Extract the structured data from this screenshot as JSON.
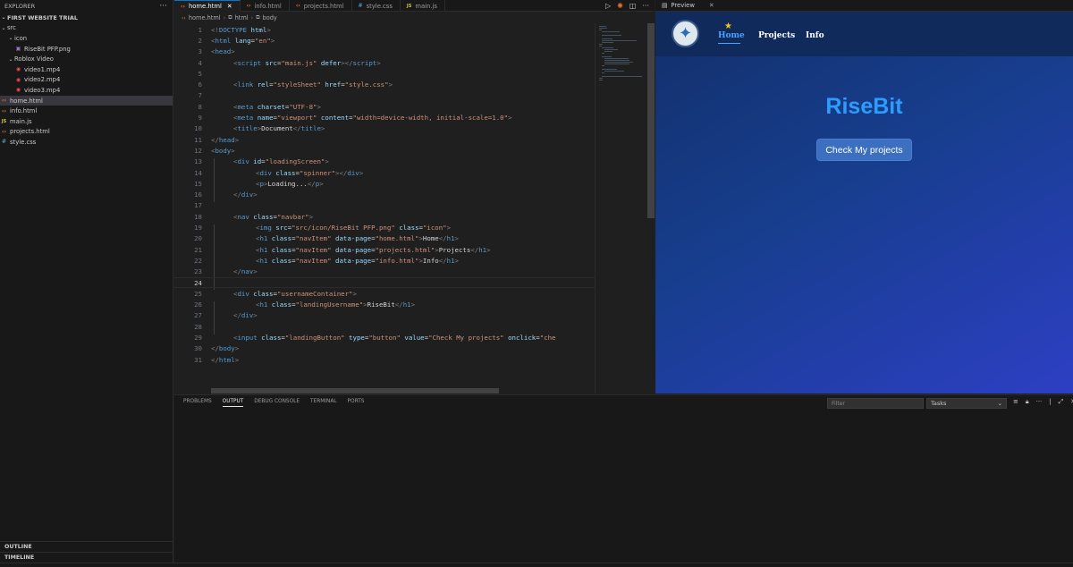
{
  "sidebar": {
    "title": "EXPLORER",
    "more": "···",
    "project": "FIRST WEBSITE TRIAL",
    "tree": [
      {
        "label": "src",
        "icon": "chevron-down",
        "depth": 1,
        "kind": "folder"
      },
      {
        "label": "icon",
        "icon": "chevron-down",
        "depth": 2,
        "kind": "folder"
      },
      {
        "label": "RiseBit PFP.png",
        "icon": "png-file-icon",
        "depth": 3,
        "kind": "png"
      },
      {
        "label": "Roblox Video",
        "icon": "chevron-down",
        "depth": 2,
        "kind": "folder"
      },
      {
        "label": "video1.mp4",
        "icon": "video-file-icon",
        "depth": 3,
        "kind": "mp4"
      },
      {
        "label": "video2.mp4",
        "icon": "video-file-icon",
        "depth": 3,
        "kind": "mp4"
      },
      {
        "label": "video3.mp4",
        "icon": "video-file-icon",
        "depth": 3,
        "kind": "mp4"
      },
      {
        "label": "home.html",
        "icon": "html-file-icon",
        "depth": 1,
        "kind": "html",
        "selected": true
      },
      {
        "label": "info.html",
        "icon": "html-file-icon",
        "depth": 1,
        "kind": "html"
      },
      {
        "label": "main.js",
        "icon": "js-file-icon",
        "depth": 1,
        "kind": "js"
      },
      {
        "label": "projects.html",
        "icon": "html-file-icon",
        "depth": 1,
        "kind": "html"
      },
      {
        "label": "style.css",
        "icon": "css-file-icon",
        "depth": 1,
        "kind": "css"
      }
    ],
    "outline": "OUTLINE",
    "timeline": "TIMELINE"
  },
  "tabs": [
    {
      "label": "home.html",
      "kind": "html",
      "active": true
    },
    {
      "label": "info.html",
      "kind": "html"
    },
    {
      "label": "projects.html",
      "kind": "html"
    },
    {
      "label": "style.css",
      "kind": "css"
    },
    {
      "label": "main.js",
      "kind": "js"
    }
  ],
  "breadcrumb": [
    "home.html",
    "html",
    "body"
  ],
  "editor": {
    "current_line": 24,
    "lines": [
      {
        "n": 1,
        "indent": 0,
        "tokens": [
          [
            "t",
            "<!"
          ],
          [
            "n",
            "DOCTYPE"
          ],
          [
            "a",
            " html"
          ],
          [
            "t",
            ">"
          ]
        ]
      },
      {
        "n": 2,
        "indent": 0,
        "tokens": [
          [
            "t",
            "<"
          ],
          [
            "n",
            "html"
          ],
          [
            "a",
            " lang"
          ],
          [
            "x",
            "="
          ],
          [
            "s",
            "\"en\""
          ],
          [
            "t",
            ">"
          ]
        ]
      },
      {
        "n": 3,
        "indent": 0,
        "tokens": [
          [
            "t",
            "<"
          ],
          [
            "n",
            "head"
          ],
          [
            "t",
            ">"
          ]
        ]
      },
      {
        "n": 4,
        "indent": 1,
        "tokens": [
          [
            "t",
            "<"
          ],
          [
            "n",
            "script"
          ],
          [
            "a",
            " src"
          ],
          [
            "x",
            "="
          ],
          [
            "s",
            "\"main.js\""
          ],
          [
            "a",
            " defer"
          ],
          [
            "t",
            "></"
          ],
          [
            "n",
            "script"
          ],
          [
            "t",
            ">"
          ]
        ]
      },
      {
        "n": 5,
        "indent": 0,
        "tokens": []
      },
      {
        "n": 6,
        "indent": 1,
        "tokens": [
          [
            "t",
            "<"
          ],
          [
            "n",
            "link"
          ],
          [
            "a",
            " rel"
          ],
          [
            "x",
            "="
          ],
          [
            "s",
            "\"styleSheet\""
          ],
          [
            "a",
            " href"
          ],
          [
            "x",
            "="
          ],
          [
            "s",
            "\"style.css\""
          ],
          [
            "t",
            ">"
          ]
        ]
      },
      {
        "n": 7,
        "indent": 0,
        "tokens": []
      },
      {
        "n": 8,
        "indent": 1,
        "tokens": [
          [
            "t",
            "<"
          ],
          [
            "n",
            "meta"
          ],
          [
            "a",
            " charset"
          ],
          [
            "x",
            "="
          ],
          [
            "s",
            "\"UTF-8\""
          ],
          [
            "t",
            ">"
          ]
        ]
      },
      {
        "n": 9,
        "indent": 1,
        "tokens": [
          [
            "t",
            "<"
          ],
          [
            "n",
            "meta"
          ],
          [
            "a",
            " name"
          ],
          [
            "x",
            "="
          ],
          [
            "s",
            "\"viewport\""
          ],
          [
            "a",
            " content"
          ],
          [
            "x",
            "="
          ],
          [
            "s",
            "\"width=device-width, initial-scale=1.0\""
          ],
          [
            "t",
            ">"
          ]
        ]
      },
      {
        "n": 10,
        "indent": 1,
        "tokens": [
          [
            "t",
            "<"
          ],
          [
            "n",
            "title"
          ],
          [
            "t",
            ">"
          ],
          [
            "x",
            "Document"
          ],
          [
            "t",
            "</"
          ],
          [
            "n",
            "title"
          ],
          [
            "t",
            ">"
          ]
        ]
      },
      {
        "n": 11,
        "indent": 0,
        "tokens": [
          [
            "t",
            "</"
          ],
          [
            "n",
            "head"
          ],
          [
            "t",
            ">"
          ]
        ]
      },
      {
        "n": 12,
        "indent": 0,
        "tokens": [
          [
            "t",
            "<"
          ],
          [
            "n",
            "body"
          ],
          [
            "t",
            ">"
          ]
        ]
      },
      {
        "n": 13,
        "indent": 1,
        "tokens": [
          [
            "t",
            "<"
          ],
          [
            "n",
            "div"
          ],
          [
            "a",
            " id"
          ],
          [
            "x",
            "="
          ],
          [
            "s",
            "\"loadingScreen\""
          ],
          [
            "t",
            ">"
          ]
        ]
      },
      {
        "n": 14,
        "indent": 2,
        "tokens": [
          [
            "t",
            "<"
          ],
          [
            "n",
            "div"
          ],
          [
            "a",
            " class"
          ],
          [
            "x",
            "="
          ],
          [
            "s",
            "\"spinner\""
          ],
          [
            "t",
            "></"
          ],
          [
            "n",
            "div"
          ],
          [
            "t",
            ">"
          ]
        ]
      },
      {
        "n": 15,
        "indent": 2,
        "tokens": [
          [
            "t",
            "<"
          ],
          [
            "n",
            "p"
          ],
          [
            "t",
            ">"
          ],
          [
            "x",
            "Loading..."
          ],
          [
            "t",
            "</"
          ],
          [
            "n",
            "p"
          ],
          [
            "t",
            ">"
          ]
        ]
      },
      {
        "n": 16,
        "indent": 1,
        "tokens": [
          [
            "t",
            "</"
          ],
          [
            "n",
            "div"
          ],
          [
            "t",
            ">"
          ]
        ]
      },
      {
        "n": 17,
        "indent": 0,
        "tokens": []
      },
      {
        "n": 18,
        "indent": 1,
        "tokens": [
          [
            "t",
            "<"
          ],
          [
            "n",
            "nav"
          ],
          [
            "a",
            " class"
          ],
          [
            "x",
            "="
          ],
          [
            "s",
            "\"navbar\""
          ],
          [
            "t",
            ">"
          ]
        ]
      },
      {
        "n": 19,
        "indent": 2,
        "tokens": [
          [
            "t",
            "<"
          ],
          [
            "n",
            "img"
          ],
          [
            "a",
            " src"
          ],
          [
            "x",
            "="
          ],
          [
            "s",
            "\"src/icon/RiseBit PFP.png\""
          ],
          [
            "a",
            " class"
          ],
          [
            "x",
            "="
          ],
          [
            "s",
            "\"icon\""
          ],
          [
            "t",
            ">"
          ]
        ]
      },
      {
        "n": 20,
        "indent": 2,
        "tokens": [
          [
            "t",
            "<"
          ],
          [
            "n",
            "h1"
          ],
          [
            "a",
            " class"
          ],
          [
            "x",
            "="
          ],
          [
            "s",
            "\"navItem\""
          ],
          [
            "a",
            " data-page"
          ],
          [
            "x",
            "="
          ],
          [
            "s",
            "\"home.html\""
          ],
          [
            "t",
            ">"
          ],
          [
            "x",
            "Home"
          ],
          [
            "t",
            "</"
          ],
          [
            "n",
            "h1"
          ],
          [
            "t",
            ">"
          ]
        ]
      },
      {
        "n": 21,
        "indent": 2,
        "tokens": [
          [
            "t",
            "<"
          ],
          [
            "n",
            "h1"
          ],
          [
            "a",
            " class"
          ],
          [
            "x",
            "="
          ],
          [
            "s",
            "\"navItem\""
          ],
          [
            "a",
            " data-page"
          ],
          [
            "x",
            "="
          ],
          [
            "s",
            "\"projects.html\""
          ],
          [
            "t",
            ">"
          ],
          [
            "x",
            "Projects"
          ],
          [
            "t",
            "</"
          ],
          [
            "n",
            "h1"
          ],
          [
            "t",
            ">"
          ]
        ]
      },
      {
        "n": 22,
        "indent": 2,
        "tokens": [
          [
            "t",
            "<"
          ],
          [
            "n",
            "h1"
          ],
          [
            "a",
            " class"
          ],
          [
            "x",
            "="
          ],
          [
            "s",
            "\"navItem\""
          ],
          [
            "a",
            " data-page"
          ],
          [
            "x",
            "="
          ],
          [
            "s",
            "\"info.html\""
          ],
          [
            "t",
            ">"
          ],
          [
            "x",
            "Info"
          ],
          [
            "t",
            "</"
          ],
          [
            "n",
            "h1"
          ],
          [
            "t",
            ">"
          ]
        ]
      },
      {
        "n": 23,
        "indent": 1,
        "tokens": [
          [
            "t",
            "</"
          ],
          [
            "n",
            "nav"
          ],
          [
            "t",
            ">"
          ]
        ]
      },
      {
        "n": 24,
        "indent": 0,
        "tokens": []
      },
      {
        "n": 25,
        "indent": 1,
        "tokens": [
          [
            "t",
            "<"
          ],
          [
            "n",
            "div"
          ],
          [
            "a",
            " class"
          ],
          [
            "x",
            "="
          ],
          [
            "s",
            "\"usernameContainer\""
          ],
          [
            "t",
            ">"
          ]
        ]
      },
      {
        "n": 26,
        "indent": 2,
        "tokens": [
          [
            "t",
            "<"
          ],
          [
            "n",
            "h1"
          ],
          [
            "a",
            " class"
          ],
          [
            "x",
            "="
          ],
          [
            "s",
            "\"landingUsername\""
          ],
          [
            "t",
            ">"
          ],
          [
            "x",
            "RiseBit"
          ],
          [
            "t",
            "</"
          ],
          [
            "n",
            "h1"
          ],
          [
            "t",
            ">"
          ]
        ]
      },
      {
        "n": 27,
        "indent": 1,
        "tokens": [
          [
            "t",
            "</"
          ],
          [
            "n",
            "div"
          ],
          [
            "t",
            ">"
          ]
        ]
      },
      {
        "n": 28,
        "indent": 0,
        "tokens": []
      },
      {
        "n": 29,
        "indent": 1,
        "tokens": [
          [
            "t",
            "<"
          ],
          [
            "n",
            "input"
          ],
          [
            "a",
            " class"
          ],
          [
            "x",
            "="
          ],
          [
            "s",
            "\"landingButton\""
          ],
          [
            "a",
            " type"
          ],
          [
            "x",
            "="
          ],
          [
            "s",
            "\"button\""
          ],
          [
            "a",
            " value"
          ],
          [
            "x",
            "="
          ],
          [
            "s",
            "\"Check My projects\""
          ],
          [
            "a",
            " onclick"
          ],
          [
            "x",
            "="
          ],
          [
            "s",
            "\"che"
          ]
        ]
      },
      {
        "n": 30,
        "indent": 0,
        "tokens": [
          [
            "t",
            "</"
          ],
          [
            "n",
            "body"
          ],
          [
            "t",
            ">"
          ]
        ]
      },
      {
        "n": 31,
        "indent": 0,
        "tokens": [
          [
            "t",
            "</"
          ],
          [
            "n",
            "html"
          ],
          [
            "t",
            ">"
          ]
        ]
      }
    ]
  },
  "preview": {
    "tab_label": "Preview",
    "nav": [
      {
        "label": "Home",
        "active": true
      },
      {
        "label": "Projects"
      },
      {
        "label": "Info"
      }
    ],
    "title": "RiseBit",
    "button": "Check My projects"
  },
  "panel": {
    "tabs": [
      "PROBLEMS",
      "OUTPUT",
      "DEBUG CONSOLE",
      "TERMINAL",
      "PORTS"
    ],
    "active_tab": "OUTPUT",
    "filter_placeholder": "Filter",
    "output_channel": "Tasks"
  },
  "colors": {
    "accent": "#0078d4",
    "preview_title": "#2e9cff"
  }
}
